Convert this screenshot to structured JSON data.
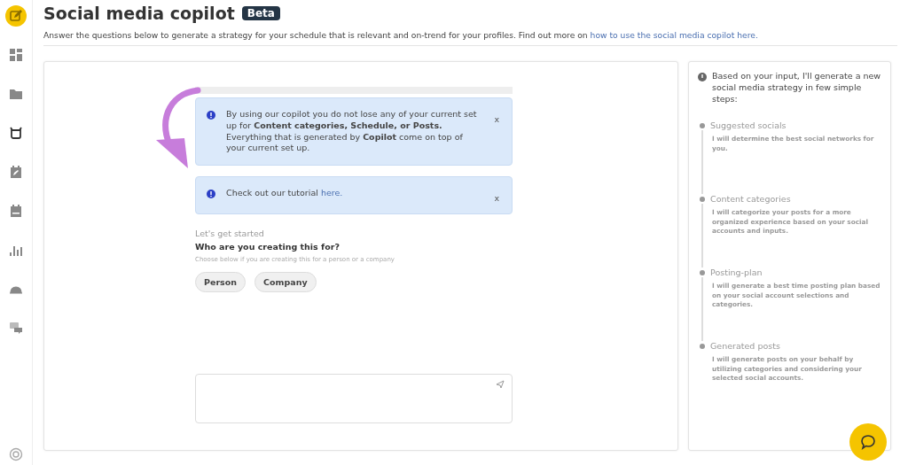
{
  "sidebar": {
    "items": [
      {
        "kind": "compose",
        "selected": true
      },
      {
        "kind": "dashboard",
        "selected": false
      },
      {
        "kind": "folder",
        "selected": false
      },
      {
        "kind": "robot",
        "selected": false
      },
      {
        "kind": "calendar-edit",
        "selected": false
      },
      {
        "kind": "calendar",
        "selected": false
      },
      {
        "kind": "chart",
        "selected": false
      },
      {
        "kind": "cloche",
        "selected": false
      },
      {
        "kind": "chat",
        "selected": false
      }
    ],
    "footer": {
      "kind": "help"
    }
  },
  "header": {
    "title": "Social media copilot",
    "badge": "Beta",
    "subtitle": "Answer the questions below to generate a strategy for your schedule that is relevant and on-trend for your profiles. Find out more on",
    "subtitle_link": "how to use the social media copilot here."
  },
  "notices": [
    {
      "text": "By using our copilot you do not lose any of your current set up for **Content categories, Schedule, or Posts.** Everything that is generated by **Copilot** come on top of your current set up.",
      "close": "x"
    },
    {
      "text": "Check out our tutorial",
      "link": "here.",
      "close": "x"
    }
  ],
  "question": {
    "intro": "Let's get started",
    "title": "Who are you creating this for?",
    "hint": "Choose below if you are creating this for a person or a company",
    "options": [
      {
        "label": "Person",
        "selected": false
      },
      {
        "label": "Company",
        "selected": false
      }
    ]
  },
  "steps_panel": {
    "intro": "Based on your input, I'll generate a new social media strategy in few simple steps:",
    "steps": [
      {
        "title": "Suggested socials",
        "text": "I will determine the best social networks for you."
      },
      {
        "title": "Content categories",
        "text": "I will categorize your posts for a more organized experience based on your social accounts and inputs."
      },
      {
        "title": "Posting-plan",
        "text": "I will generate a best time posting plan based on your social account selections and categories."
      },
      {
        "title": "Generated posts",
        "text": "I will generate posts on your behalf by utilizing categories and considering your selected social accounts."
      }
    ]
  }
}
